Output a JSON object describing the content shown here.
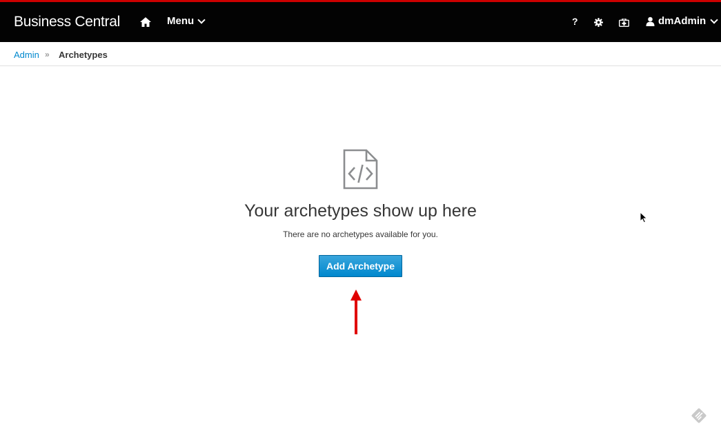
{
  "navbar": {
    "brand": "Business Central",
    "menu_label": "Menu",
    "help_label": "?",
    "user_label": "dmAdmin",
    "icons": {
      "home": "home-icon",
      "settings": "gear-icon",
      "kit": "medkit-icon",
      "user": "user-icon"
    },
    "accent_color": "#cc0000"
  },
  "breadcrumb": {
    "parent": "Admin",
    "separator": "»",
    "current": "Archetypes"
  },
  "empty_state": {
    "icon": "file-code-icon",
    "title": "Your archetypes show up here",
    "text": "There are no archetypes available for you.",
    "button_label": "Add Archetype",
    "button_color": "#0088ce"
  },
  "annotation": {
    "arrow_color": "#e00000"
  }
}
